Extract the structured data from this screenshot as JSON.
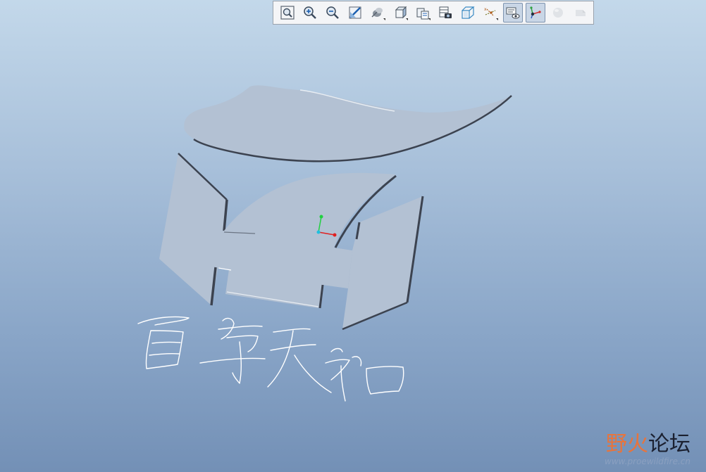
{
  "window": {
    "view": "3d-model-viewport"
  },
  "toolbar": {
    "buttons": [
      {
        "name": "refit-view",
        "icon": "refit-icon",
        "active": false,
        "flyout": false
      },
      {
        "name": "zoom-in",
        "icon": "zoom-in-icon",
        "active": false,
        "flyout": false
      },
      {
        "name": "zoom-out",
        "icon": "zoom-out-icon",
        "active": false,
        "flyout": false
      },
      {
        "name": "repaint",
        "icon": "repaint-icon",
        "active": false,
        "flyout": false
      },
      {
        "name": "display-style",
        "icon": "shading-icon",
        "active": false,
        "flyout": true
      },
      {
        "name": "saved-orientations",
        "icon": "cube-icon",
        "active": false,
        "flyout": true
      },
      {
        "name": "view-manager",
        "icon": "view-manager-icon",
        "active": false,
        "flyout": true
      },
      {
        "name": "appearances",
        "icon": "camera-table-icon",
        "active": false,
        "flyout": false
      },
      {
        "name": "perspective",
        "icon": "wire-cube-icon",
        "active": false,
        "flyout": false
      },
      {
        "name": "datum-display",
        "icon": "datum-icon",
        "active": false,
        "flyout": true
      },
      {
        "name": "annotation-display",
        "icon": "annotation-eye-icon",
        "active": true,
        "flyout": false
      },
      {
        "name": "spin-center",
        "icon": "spin-center-icon",
        "active": true,
        "flyout": false
      },
      {
        "name": "sphere",
        "icon": "sphere-icon",
        "active": false,
        "disabled": true,
        "flyout": false
      },
      {
        "name": "section",
        "icon": "section-icon",
        "active": false,
        "disabled": true,
        "flyout": false
      }
    ]
  },
  "colors": {
    "background_top": "#c3d8ea",
    "background_bottom": "#7390b6",
    "part_fill": "#b3c1d3",
    "part_edge": "#3c4350",
    "text_outline": "#ffffff",
    "axis_x": "#e02020",
    "axis_y": "#20d040",
    "axis_origin": "#20c0e0"
  },
  "watermark": {
    "title_part1": "野火",
    "title_part2": "论坛",
    "url": "www.proewildfire.cn"
  }
}
